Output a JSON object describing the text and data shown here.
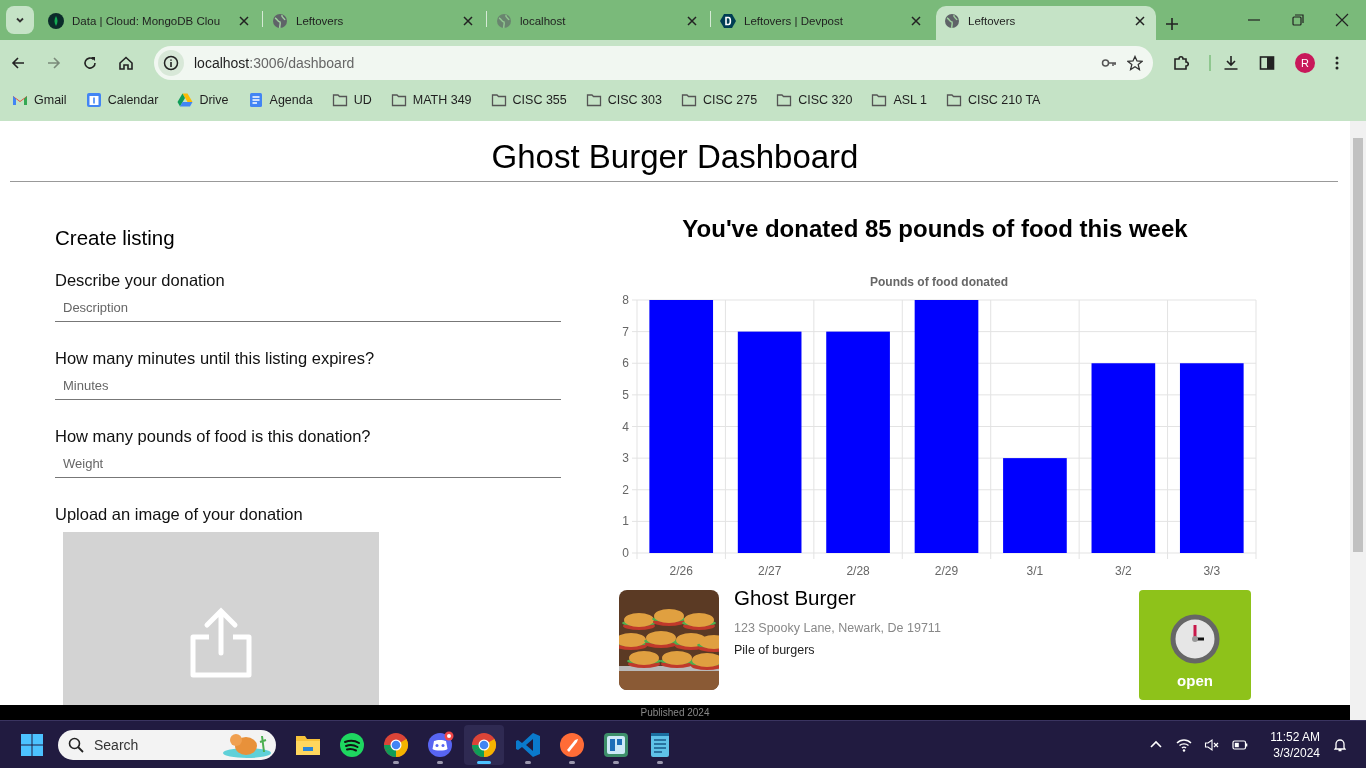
{
  "browser": {
    "tabs": [
      {
        "title": "Data | Cloud: MongoDB Clou",
        "selected": false
      },
      {
        "title": "Leftovers",
        "selected": false
      },
      {
        "title": "localhost",
        "selected": false
      },
      {
        "title": "Leftovers | Devpost",
        "selected": false
      },
      {
        "title": "Leftovers",
        "selected": true
      }
    ],
    "url": {
      "host": "localhost",
      "path": ":3006/dashboard"
    },
    "profile": "R",
    "bookmarks": [
      {
        "label": "Gmail",
        "kind": "gmail"
      },
      {
        "label": "Calendar",
        "kind": "calendar"
      },
      {
        "label": "Drive",
        "kind": "drive"
      },
      {
        "label": "Agenda",
        "kind": "agenda"
      },
      {
        "label": "UD",
        "kind": "folder"
      },
      {
        "label": "MATH 349",
        "kind": "folder"
      },
      {
        "label": "CISC 355",
        "kind": "folder"
      },
      {
        "label": "CISC 303",
        "kind": "folder"
      },
      {
        "label": "CISC 275",
        "kind": "folder"
      },
      {
        "label": "CISC 320",
        "kind": "folder"
      },
      {
        "label": "ASL 1",
        "kind": "folder"
      },
      {
        "label": "CISC 210 TA",
        "kind": "folder"
      }
    ]
  },
  "page": {
    "title": "Ghost Burger Dashboard",
    "form": {
      "heading": "Create listing",
      "fields": [
        {
          "label": "Describe your donation",
          "placeholder": "Description"
        },
        {
          "label": "How many minutes until this listing expires?",
          "placeholder": "Minutes"
        },
        {
          "label": "How many pounds of food is this donation?",
          "placeholder": "Weight"
        }
      ],
      "upload_label": "Upload an image of your donation"
    },
    "summary": "You've donated 85 pounds of food this week",
    "chart_data": {
      "type": "bar",
      "title": "Pounds of food donated",
      "categories": [
        "2/26",
        "2/27",
        "2/28",
        "2/29",
        "3/1",
        "3/2",
        "3/3"
      ],
      "series": [
        {
          "color": "#0000ff",
          "values": [
            8,
            7,
            7,
            8,
            3,
            6,
            6
          ]
        }
      ],
      "ylim": [
        0,
        8
      ],
      "yticks": [
        0,
        1,
        2,
        3,
        4,
        5,
        6,
        7,
        8
      ],
      "grid": true
    },
    "listing": {
      "name": "Ghost Burger",
      "address": "123 Spooky Lane, Newark, De 19711",
      "description": "Pile of burgers",
      "status": "open"
    },
    "footer": "Published 2024"
  },
  "taskbar": {
    "search_placeholder": "Search",
    "apps": [
      {
        "kind": "files",
        "running": false,
        "selected": false
      },
      {
        "kind": "spotify",
        "running": false,
        "selected": false
      },
      {
        "kind": "chrome",
        "running": true,
        "selected": false
      },
      {
        "kind": "discord",
        "running": true,
        "selected": false
      },
      {
        "kind": "chrome",
        "running": true,
        "selected": true
      },
      {
        "kind": "vscode",
        "running": true,
        "selected": false
      },
      {
        "kind": "postman",
        "running": true,
        "selected": false
      },
      {
        "kind": "board",
        "running": true,
        "selected": false
      },
      {
        "kind": "notepad",
        "running": true,
        "selected": false
      }
    ],
    "time": "11:52 AM",
    "date": "3/3/2024"
  }
}
